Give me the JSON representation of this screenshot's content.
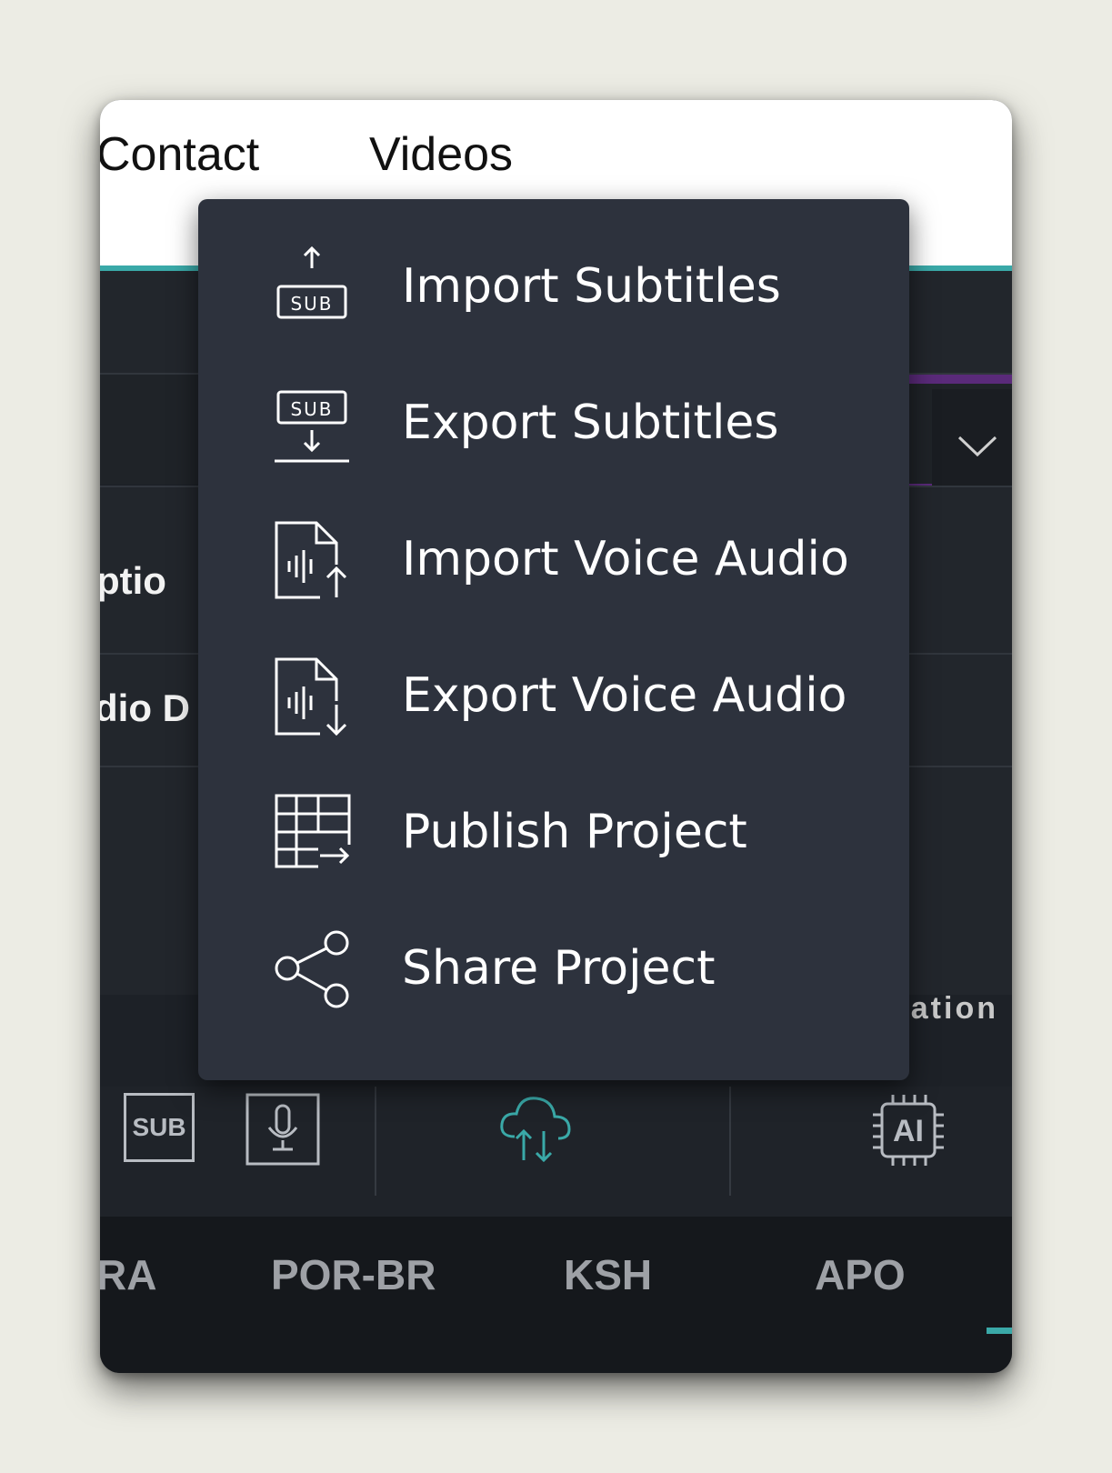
{
  "topnav": {
    "contact": "Contact",
    "videos": "Videos"
  },
  "background": {
    "row1_label": "ptio",
    "row2_label": "dio D",
    "nation_label": "nation",
    "sub_icon_text": "SUB",
    "ai_icon_text": "AI"
  },
  "languages": [
    "RA",
    "POR-BR",
    "KSH",
    "APO"
  ],
  "menu": {
    "items": [
      {
        "label": "Import Subtitles",
        "icon": "import-subtitles-icon"
      },
      {
        "label": "Export Subtitles",
        "icon": "export-subtitles-icon"
      },
      {
        "label": "Import Voice Audio",
        "icon": "import-voice-audio-icon"
      },
      {
        "label": "Export Voice Audio",
        "icon": "export-voice-audio-icon"
      },
      {
        "label": "Publish Project",
        "icon": "publish-project-icon"
      },
      {
        "label": "Share Project",
        "icon": "share-project-icon"
      }
    ],
    "icon_sub_text": "SUB"
  },
  "colors": {
    "accent": "#3aa9a8",
    "menu_bg": "#2d323d",
    "purple": "#5a2a7a"
  }
}
